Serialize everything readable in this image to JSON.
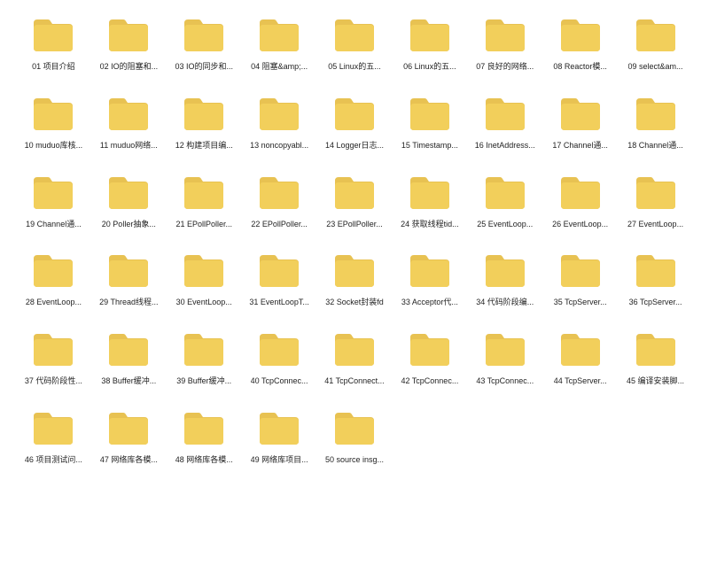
{
  "folders": [
    {
      "label": "01 项目介绍"
    },
    {
      "label": "02 IO的阻塞和..."
    },
    {
      "label": "03 IO的同步和..."
    },
    {
      "label": "04 阻塞&amp;..."
    },
    {
      "label": "05 Linux的五..."
    },
    {
      "label": "06 Linux的五..."
    },
    {
      "label": "07 良好的网络..."
    },
    {
      "label": "08 Reactor模..."
    },
    {
      "label": "09 select&am..."
    },
    {
      "label": "10 muduo库核..."
    },
    {
      "label": "11 muduo网络..."
    },
    {
      "label": "12 构建项目编..."
    },
    {
      "label": "13 noncopyabl..."
    },
    {
      "label": "14 Logger日志..."
    },
    {
      "label": "15 Timestamp..."
    },
    {
      "label": "16 InetAddress..."
    },
    {
      "label": "17 Channel通..."
    },
    {
      "label": "18 Channel通..."
    },
    {
      "label": "19 Channel通..."
    },
    {
      "label": "20 Poller抽象..."
    },
    {
      "label": "21 EPollPoller..."
    },
    {
      "label": "22 EPollPoller..."
    },
    {
      "label": "23 EPollPoller..."
    },
    {
      "label": "24 获取线程tid..."
    },
    {
      "label": "25 EventLoop..."
    },
    {
      "label": "26 EventLoop..."
    },
    {
      "label": "27 EventLoop..."
    },
    {
      "label": "28 EventLoop..."
    },
    {
      "label": "29 Thread线程..."
    },
    {
      "label": "30 EventLoop..."
    },
    {
      "label": "31 EventLoopT..."
    },
    {
      "label": "32 Socket封装fd"
    },
    {
      "label": "33 Acceptor代..."
    },
    {
      "label": "34 代码阶段编..."
    },
    {
      "label": "35 TcpServer..."
    },
    {
      "label": "36 TcpServer..."
    },
    {
      "label": "37 代码阶段性..."
    },
    {
      "label": "38 Buffer缓冲..."
    },
    {
      "label": "39 Buffer缓冲..."
    },
    {
      "label": "40 TcpConnec..."
    },
    {
      "label": "41 TcpConnect..."
    },
    {
      "label": "42 TcpConnec..."
    },
    {
      "label": "43 TcpConnec..."
    },
    {
      "label": "44 TcpServer..."
    },
    {
      "label": "45 编译安装脚..."
    },
    {
      "label": "46 项目测试问..."
    },
    {
      "label": "47 网络库各模..."
    },
    {
      "label": "48 网络库各模..."
    },
    {
      "label": "49 网络库项目..."
    },
    {
      "label": "50 source insg..."
    }
  ]
}
